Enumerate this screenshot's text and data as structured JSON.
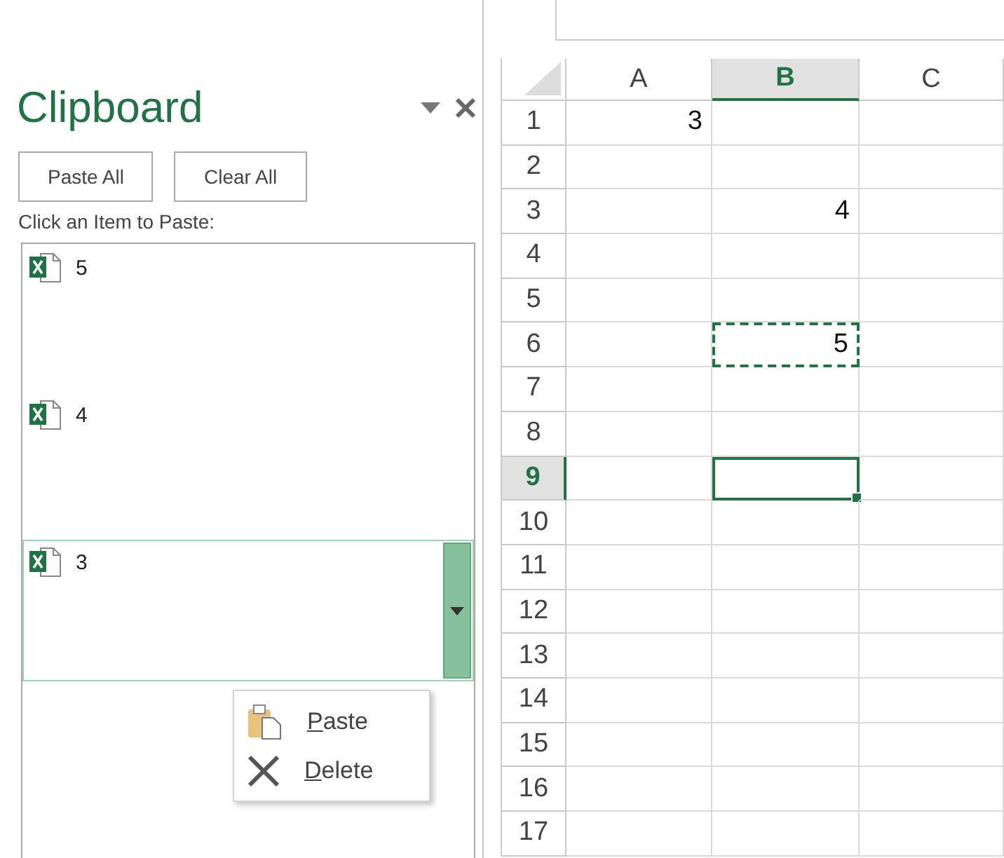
{
  "pane": {
    "title": "Clipboard",
    "buttons": [
      "Paste All",
      "Clear All"
    ],
    "instruction": "Click an Item to Paste:",
    "items": [
      {
        "text": "5",
        "selected": false
      },
      {
        "text": "4",
        "selected": false
      },
      {
        "text": "3",
        "selected": true
      }
    ],
    "context_menu": [
      {
        "kind": "paste",
        "label": "Paste"
      },
      {
        "kind": "delete",
        "label": "Delete"
      }
    ]
  },
  "grid": {
    "columns": [
      {
        "label": "A",
        "selected": false
      },
      {
        "label": "B",
        "selected": true
      },
      {
        "label": "C",
        "selected": false
      }
    ],
    "rows": [
      {
        "label": "1",
        "selected": false,
        "cells": [
          {
            "text": "3",
            "copied": false,
            "active": false
          },
          {
            "copied": false,
            "active": false
          },
          {
            "copied": false,
            "active": false
          }
        ]
      },
      {
        "label": "2",
        "selected": false,
        "cells": [
          {
            "copied": false,
            "active": false
          },
          {
            "copied": false,
            "active": false
          },
          {
            "copied": false,
            "active": false
          }
        ]
      },
      {
        "label": "3",
        "selected": false,
        "cells": [
          {
            "copied": false,
            "active": false
          },
          {
            "text": "4",
            "copied": false,
            "active": false
          },
          {
            "copied": false,
            "active": false
          }
        ]
      },
      {
        "label": "4",
        "selected": false,
        "cells": [
          {
            "copied": false,
            "active": false
          },
          {
            "copied": false,
            "active": false
          },
          {
            "copied": false,
            "active": false
          }
        ]
      },
      {
        "label": "5",
        "selected": false,
        "cells": [
          {
            "copied": false,
            "active": false
          },
          {
            "copied": false,
            "active": false
          },
          {
            "copied": false,
            "active": false
          }
        ]
      },
      {
        "label": "6",
        "selected": false,
        "cells": [
          {
            "copied": false,
            "active": false
          },
          {
            "text": "5",
            "copied": true,
            "active": false
          },
          {
            "copied": false,
            "active": false
          }
        ]
      },
      {
        "label": "7",
        "selected": false,
        "cells": [
          {
            "copied": false,
            "active": false
          },
          {
            "copied": false,
            "active": false
          },
          {
            "copied": false,
            "active": false
          }
        ]
      },
      {
        "label": "8",
        "selected": false,
        "cells": [
          {
            "copied": false,
            "active": false
          },
          {
            "copied": false,
            "active": false
          },
          {
            "copied": false,
            "active": false
          }
        ]
      },
      {
        "label": "9",
        "selected": true,
        "cells": [
          {
            "copied": false,
            "active": false
          },
          {
            "copied": false,
            "active": true
          },
          {
            "copied": false,
            "active": false
          }
        ]
      },
      {
        "label": "10",
        "selected": false,
        "cells": [
          {
            "copied": false,
            "active": false
          },
          {
            "copied": false,
            "active": false
          },
          {
            "copied": false,
            "active": false
          }
        ]
      },
      {
        "label": "11",
        "selected": false,
        "cells": [
          {
            "copied": false,
            "active": false
          },
          {
            "copied": false,
            "active": false
          },
          {
            "copied": false,
            "active": false
          }
        ]
      },
      {
        "label": "12",
        "selected": false,
        "cells": [
          {
            "copied": false,
            "active": false
          },
          {
            "copied": false,
            "active": false
          },
          {
            "copied": false,
            "active": false
          }
        ]
      },
      {
        "label": "13",
        "selected": false,
        "cells": [
          {
            "copied": false,
            "active": false
          },
          {
            "copied": false,
            "active": false
          },
          {
            "copied": false,
            "active": false
          }
        ]
      },
      {
        "label": "14",
        "selected": false,
        "cells": [
          {
            "copied": false,
            "active": false
          },
          {
            "copied": false,
            "active": false
          },
          {
            "copied": false,
            "active": false
          }
        ]
      },
      {
        "label": "15",
        "selected": false,
        "cells": [
          {
            "copied": false,
            "active": false
          },
          {
            "copied": false,
            "active": false
          },
          {
            "copied": false,
            "active": false
          }
        ]
      },
      {
        "label": "16",
        "selected": false,
        "cells": [
          {
            "copied": false,
            "active": false
          },
          {
            "copied": false,
            "active": false
          },
          {
            "copied": false,
            "active": false
          }
        ]
      },
      {
        "label": "17",
        "selected": false,
        "cells": [
          {
            "copied": false,
            "active": false
          },
          {
            "copied": false,
            "active": false
          },
          {
            "copied": false,
            "active": false
          }
        ]
      }
    ]
  }
}
